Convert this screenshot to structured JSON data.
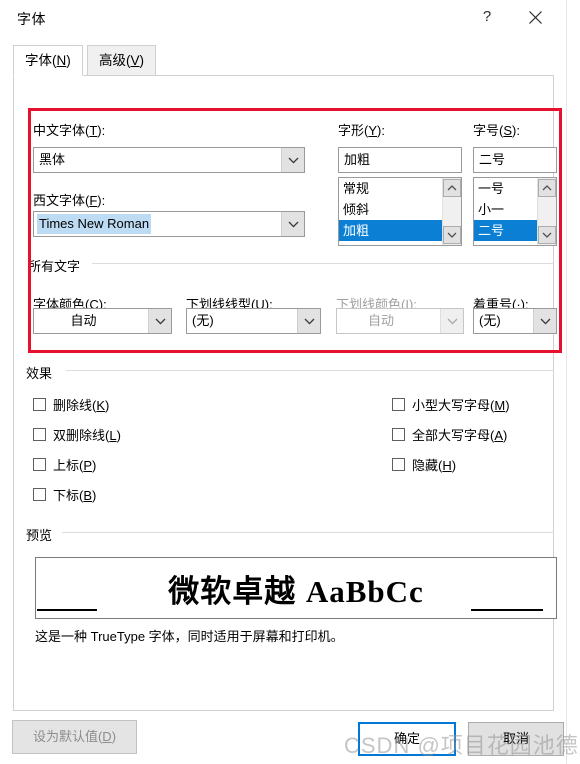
{
  "window": {
    "title": "字体",
    "help_icon": "question-mark-icon",
    "close_icon": "close-icon"
  },
  "tabs": [
    {
      "label": "字体(N)",
      "active": true
    },
    {
      "label": "高级(V)",
      "active": false
    }
  ],
  "font_section": {
    "chinese_font": {
      "label": "中文字体(T):",
      "value": "黑体"
    },
    "western_font": {
      "label": "西文字体(F):",
      "value": "Times New Roman",
      "selected": true
    },
    "style": {
      "label": "字形(Y):",
      "value": "加粗",
      "options": [
        "常规",
        "倾斜",
        "加粗"
      ],
      "selected": "加粗"
    },
    "size": {
      "label": "字号(S):",
      "value": "二号",
      "options": [
        "一号",
        "小一",
        "二号"
      ],
      "selected": "二号"
    }
  },
  "all_text_group": {
    "title": "所有文字",
    "font_color": {
      "label": "字体颜色(C):",
      "value": "自动",
      "disabled": false
    },
    "underline_style": {
      "label": "下划线线型(U):",
      "value": "(无)",
      "disabled": false
    },
    "underline_color": {
      "label": "下划线颜色(I):",
      "value": "自动",
      "disabled": true
    },
    "emphasis_mark": {
      "label": "着重号(·):",
      "value": "(无)",
      "disabled": false
    }
  },
  "effects_group": {
    "title": "效果",
    "left_column": [
      {
        "label": "删除线(K)",
        "checked": false
      },
      {
        "label": "双删除线(L)",
        "checked": false
      },
      {
        "label": "上标(P)",
        "checked": false
      },
      {
        "label": "下标(B)",
        "checked": false
      }
    ],
    "right_column": [
      {
        "label": "小型大写字母(M)",
        "checked": false
      },
      {
        "label": "全部大写字母(A)",
        "checked": false
      },
      {
        "label": "隐藏(H)",
        "checked": false
      }
    ]
  },
  "preview_group": {
    "title": "预览",
    "sample_cjk": "微软卓越",
    "sample_latin": "AaBbCc",
    "note": "这是一种 TrueType 字体，同时适用于屏幕和打印机。"
  },
  "footer": {
    "set_default": "设为默认值(D)",
    "ok": "确定",
    "cancel": "取消"
  },
  "annotation": {
    "highlight_color": "#e8112d"
  },
  "watermark": {
    "text": "CSDN @项目花园池德彪"
  }
}
